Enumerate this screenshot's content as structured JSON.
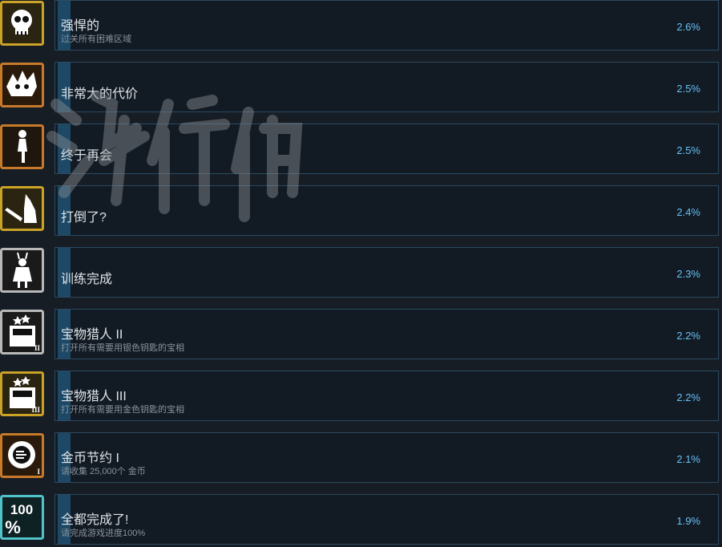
{
  "achievements": [
    {
      "title": "强悍的",
      "desc": "过关所有困难区域",
      "pct": "2.6%",
      "icon": "skull-icon",
      "frame": "#c9a227",
      "bg": "#2a2410"
    },
    {
      "title": "非常大的代价",
      "desc": "",
      "pct": "2.5%",
      "icon": "monster-icon",
      "frame": "#c77a2a",
      "bg": "#2a1a0c"
    },
    {
      "title": "终于再会",
      "desc": "",
      "pct": "2.5%",
      "icon": "silhouette-icon",
      "frame": "#c77a2a",
      "bg": "#1f160e"
    },
    {
      "title": "打倒了?",
      "desc": "",
      "pct": "2.4%",
      "icon": "sword-warrior-icon",
      "frame": "#c9a227",
      "bg": "#2a2410"
    },
    {
      "title": "训练完成",
      "desc": "",
      "pct": "2.3%",
      "icon": "trainee-icon",
      "frame": "#b8b8b8",
      "bg": "#1a1a1a"
    },
    {
      "title": "宝物猎人 II",
      "desc": "打开所有需要用银色钥匙的宝相",
      "pct": "2.2%",
      "icon": "treasure-chest-icon",
      "frame": "#b8b8b8",
      "bg": "#1a1a1a",
      "badge": "II"
    },
    {
      "title": "宝物猎人 III",
      "desc": "打开所有需要用金色钥匙的宝相",
      "pct": "2.2%",
      "icon": "treasure-chest-icon",
      "frame": "#c9a227",
      "bg": "#2a2410",
      "badge": "III"
    },
    {
      "title": "金币节约 I",
      "desc": "请收集 25,000个 金币",
      "pct": "2.1%",
      "icon": "coin-icon",
      "frame": "#c77a2a",
      "bg": "#2a1a0c",
      "badge": "I"
    },
    {
      "title": "全都完成了!",
      "desc": "请完成游戏进度100%",
      "pct": "1.9%",
      "icon": "hundred-percent-icon",
      "frame": "#4fc3c8",
      "bg": "#0e2224",
      "badge_text": "100%"
    }
  ],
  "watermark": "游侠网"
}
